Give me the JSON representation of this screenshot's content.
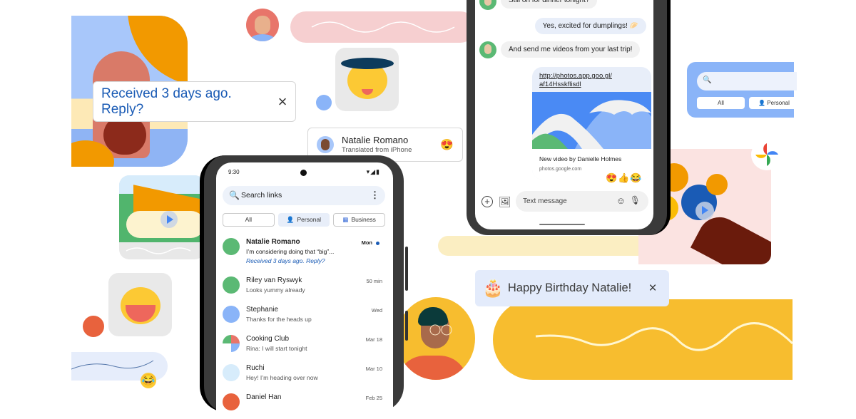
{
  "reply_toast": {
    "text": "Received 3 days ago. Reply?",
    "close_icon": "×"
  },
  "translated_card": {
    "name": "Natalie Romano",
    "subtitle": "Translated from iPhone",
    "reaction": "😍"
  },
  "birthday_toast": {
    "cake_icon": "🎂",
    "text": "Happy Birthday Natalie!",
    "close_icon": "×"
  },
  "phone_list": {
    "status": {
      "time": "9:30",
      "icons": "▾◢▮"
    },
    "search": {
      "placeholder": "Search links",
      "search_icon": "🔍",
      "more_icon": "⋮"
    },
    "chips": [
      {
        "label": "All",
        "icon": ""
      },
      {
        "label": "Personal",
        "icon": "👤"
      },
      {
        "label": "Business",
        "icon": "▦"
      }
    ],
    "conversations": [
      {
        "name": "Natalie Romano",
        "preview": "I’m considering doing that “big”...",
        "extra": "Received 3 days ago. Reply?",
        "date": "Mon",
        "unread": true,
        "avatar_color": "#5bb974"
      },
      {
        "name": "Riley van Ryswyk",
        "preview": "Looks yummy already",
        "date": "50 min",
        "avatar_color": "#5bb974"
      },
      {
        "name": "Stephanie",
        "preview": "Thanks for the heads up",
        "date": "Wed",
        "avatar_color": "#8ab4f8"
      },
      {
        "name": "Cooking Club",
        "preview": "Rina: I will start tonight",
        "date": "Mar 18",
        "avatar_color": "#e8756a"
      },
      {
        "name": "Ruchi",
        "preview": "Hey! I’m heading over now",
        "date": "Mar 10",
        "avatar_color": "#d7ecfb"
      },
      {
        "name": "Daniel Han",
        "preview": "",
        "date": "Feb 25",
        "avatar_color": "#e8623d"
      }
    ]
  },
  "phone_chat": {
    "messages": [
      {
        "direction": "in",
        "text": "Still on for dinner tonight?"
      },
      {
        "direction": "out",
        "text": "Yes, excited for dumplings! 🥟"
      },
      {
        "direction": "in",
        "text": "And send me videos from your last trip!"
      }
    ],
    "link_card": {
      "url_line1": "http://photos.app.goo.gl/",
      "url_line2": "af14Hsskflisdl",
      "title": "New video by Danielle Holmes",
      "host": "photos.google.com",
      "reactions": "😍👍😂"
    },
    "compose": {
      "placeholder": "Text message",
      "add_icon": "+",
      "gallery_icon": "🖼",
      "emoji_icon": "☺",
      "mic_icon": "🎙"
    }
  },
  "search_card": {
    "search_icon": "🔍",
    "chips": [
      "All",
      "Personal"
    ]
  },
  "stickers": {
    "cowboy": "cat-cowboy",
    "laughing_cat": "cat-laughing",
    "laugh_emoji": "😂"
  },
  "colors": {
    "accent_blue": "#1a5bb5",
    "yellow": "#f7bd2f",
    "pink": "#f6cfd0",
    "light_blue": "#8ab4f8"
  }
}
